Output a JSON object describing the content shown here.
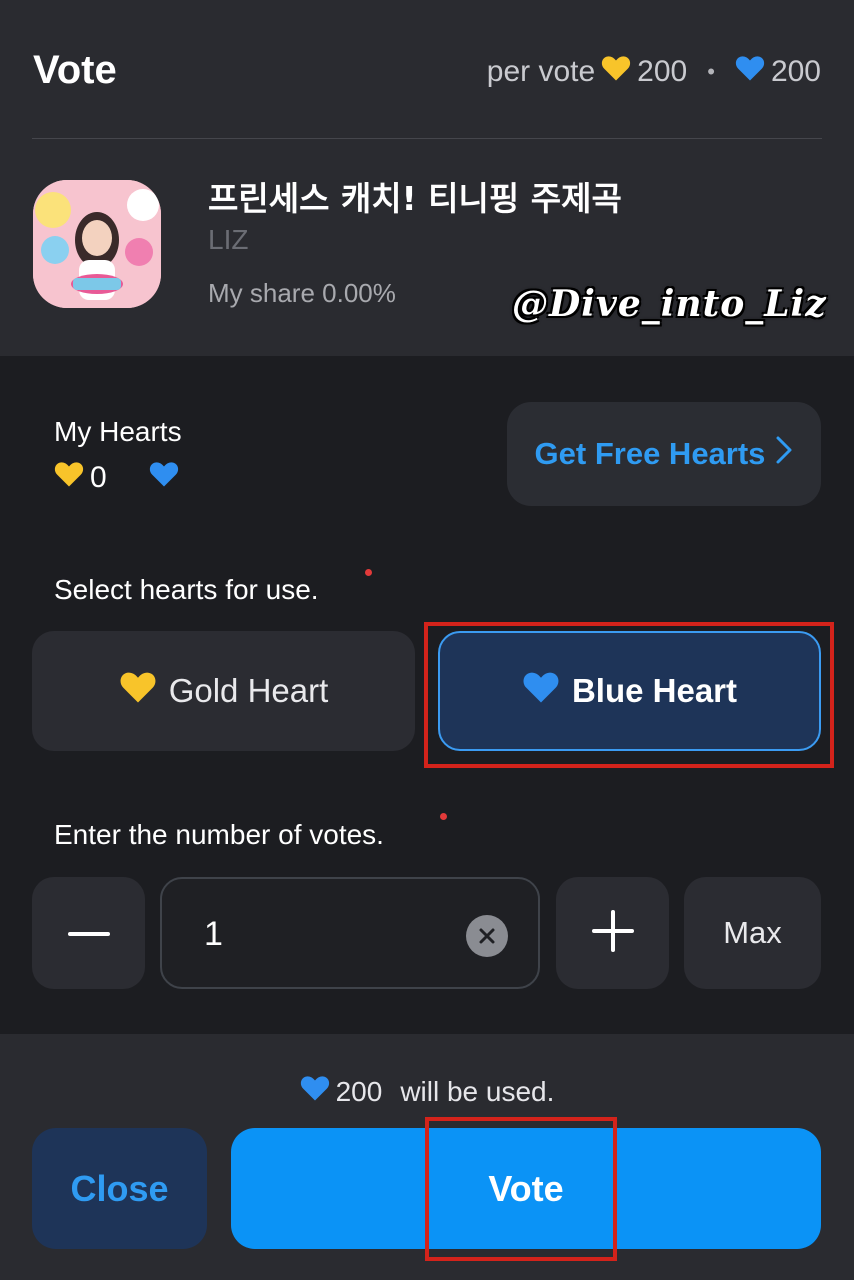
{
  "header": {
    "title": "Vote",
    "per_vote_label": "per vote",
    "gold_cost": "200",
    "separator": "•",
    "blue_cost": "200"
  },
  "song": {
    "title": "프린세스 캐치! 티니핑 주제곡",
    "artist": "LIZ",
    "share_label": "My share",
    "share_value": "0.00%",
    "watermark": "@Dive_into_Liz"
  },
  "hearts": {
    "label": "My Hearts",
    "gold_count": "0",
    "blue_count": "",
    "get_free_label": "Get Free Hearts"
  },
  "select": {
    "label": "Select hearts for use.",
    "gold_label": "Gold Heart",
    "blue_label": "Blue Heart",
    "selected": "Blue Heart"
  },
  "votes": {
    "label": "Enter the number of votes.",
    "value": "1",
    "max_label": "Max"
  },
  "footer": {
    "will_use_amount": "200",
    "will_use_text": "will be used.",
    "close_label": "Close",
    "vote_label": "Vote"
  },
  "colors": {
    "gold": "#f8c42a",
    "blue": "#2f8ef0",
    "accent": "#0b93f6",
    "annotation": "#d3231b"
  }
}
